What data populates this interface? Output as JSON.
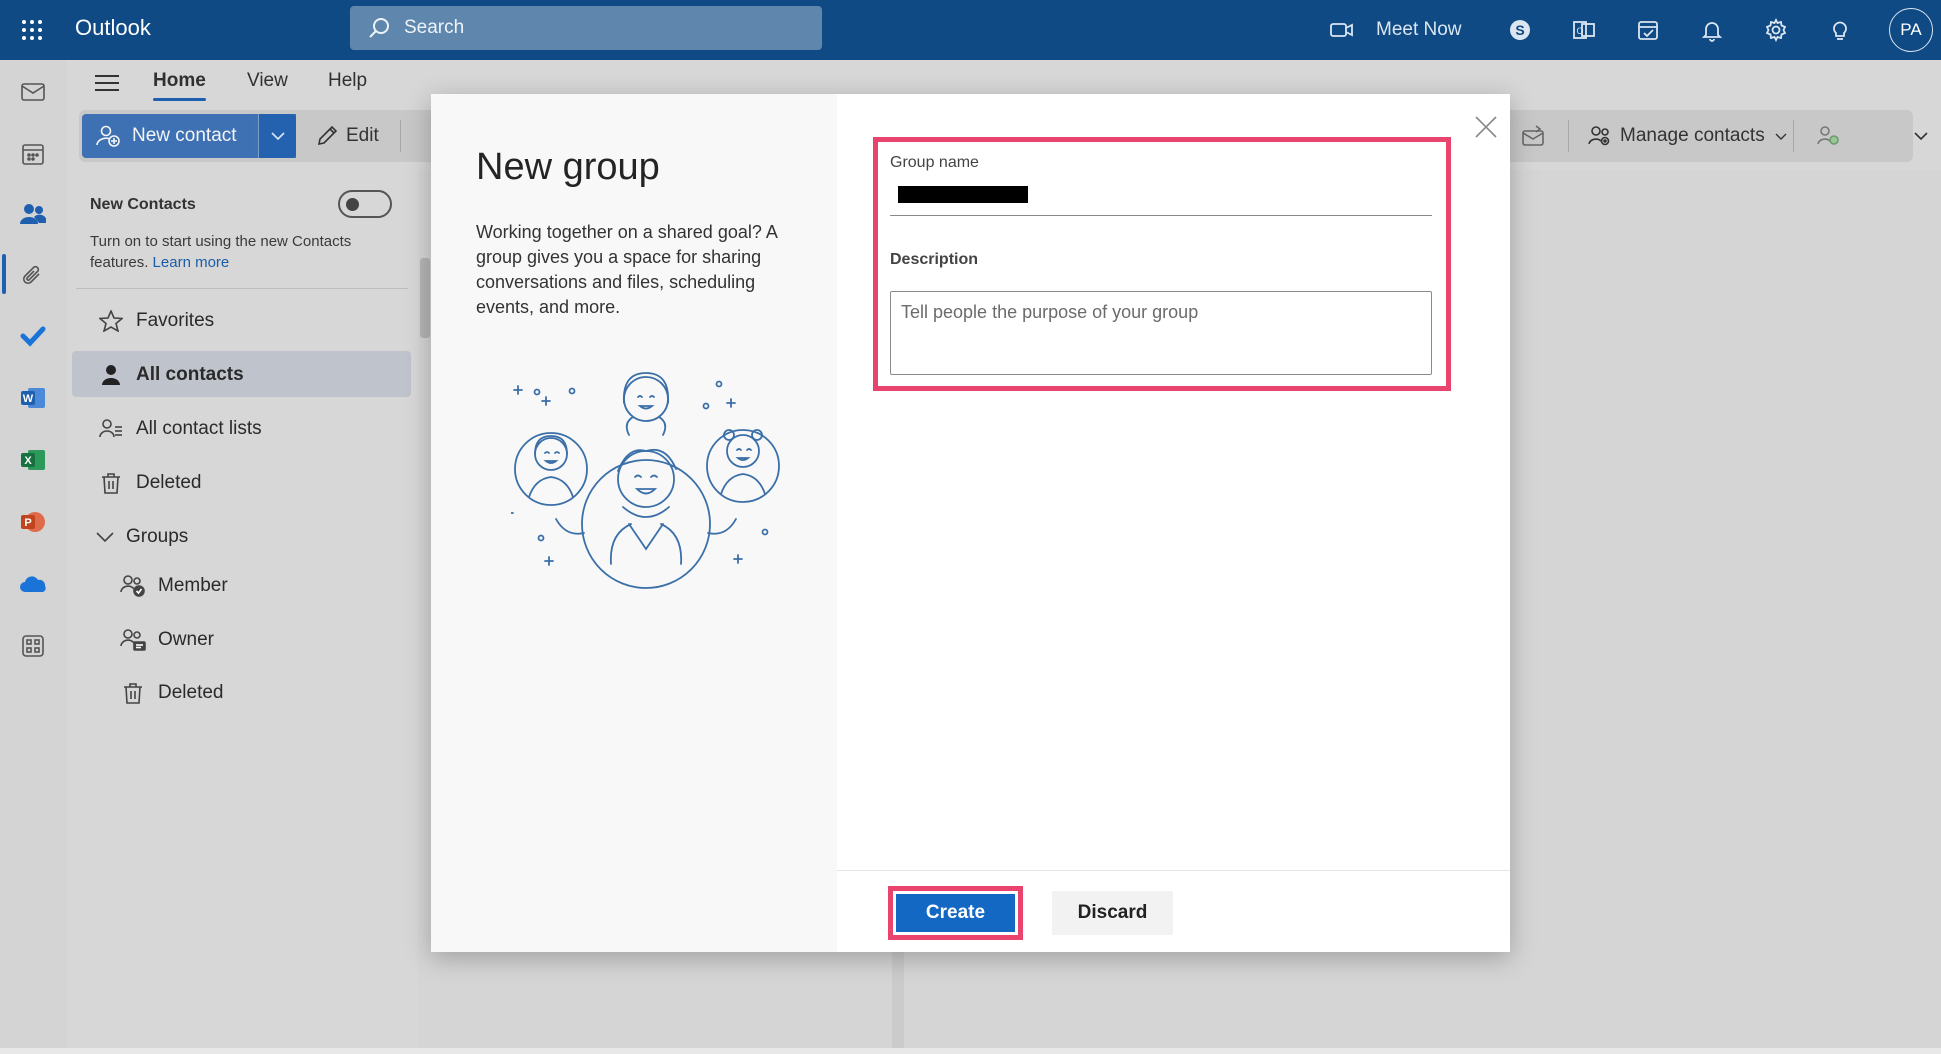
{
  "app": {
    "title": "Outlook"
  },
  "search": {
    "placeholder": "Search"
  },
  "header": {
    "meet_now": "Meet Now",
    "avatar_initials": "PA"
  },
  "ribbon": {
    "tabs": [
      {
        "label": "Home"
      },
      {
        "label": "View"
      },
      {
        "label": "Help"
      }
    ],
    "new_contact": "New contact",
    "edit": "Edit",
    "manage_contacts": "Manage contacts"
  },
  "sidebar": {
    "new_contacts_title": "New Contacts",
    "new_contacts_desc": "Turn on to start using the new Contacts features.",
    "learn_more": "Learn more",
    "items": [
      {
        "label": "Favorites"
      },
      {
        "label": "All contacts"
      },
      {
        "label": "All contact lists"
      },
      {
        "label": "Deleted"
      },
      {
        "label": "Groups"
      },
      {
        "label": "Member"
      },
      {
        "label": "Owner"
      },
      {
        "label": "Deleted"
      }
    ]
  },
  "modal": {
    "title": "New group",
    "description": "Working together on a shared goal? A group gives you a space for sharing conversations and files, scheduling events, and more.",
    "group_name_label": "Group name",
    "description_label": "Description",
    "description_placeholder": "Tell people the purpose of your group",
    "create": "Create",
    "discard": "Discard"
  },
  "colors": {
    "topbar": "#0f4a85",
    "accent": "#1368c4",
    "highlight": "#e8446e"
  }
}
